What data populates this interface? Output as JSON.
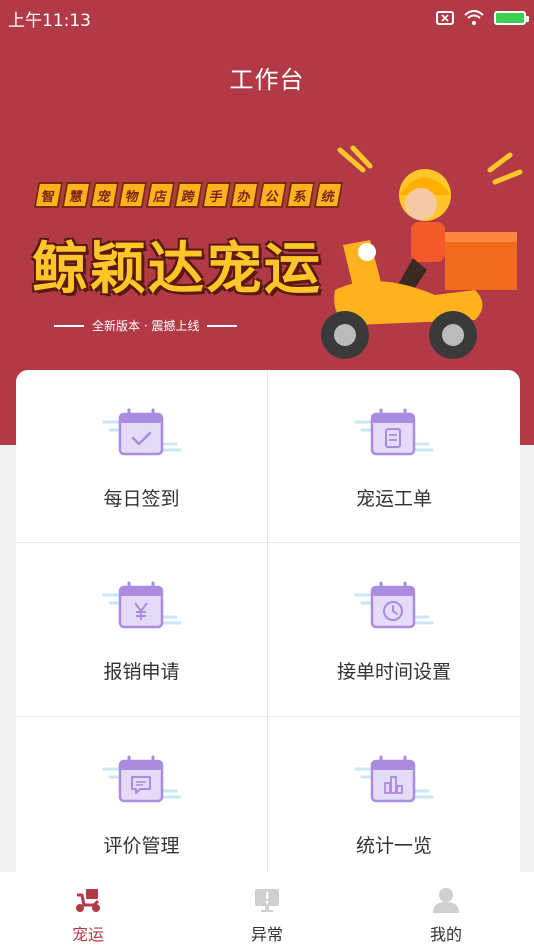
{
  "status_bar": {
    "time": "上午11:13"
  },
  "header": {
    "title": "工作台"
  },
  "banner": {
    "tagline_chars": [
      "智",
      "慧",
      "宠",
      "物",
      "店",
      "跨",
      "手",
      "办",
      "公",
      "系",
      "统"
    ],
    "brand": "鲸颖达宠运",
    "subtitle": "全新版本 · 震撼上线"
  },
  "grid": {
    "items": [
      {
        "label": "每日签到",
        "icon": "calendar-check-icon"
      },
      {
        "label": "宠运工单",
        "icon": "calendar-document-icon"
      },
      {
        "label": "报销申请",
        "icon": "calendar-yen-icon"
      },
      {
        "label": "接单时间设置",
        "icon": "calendar-clock-icon"
      },
      {
        "label": "评价管理",
        "icon": "calendar-message-icon"
      },
      {
        "label": "统计一览",
        "icon": "calendar-chart-icon"
      }
    ]
  },
  "tabbar": {
    "items": [
      {
        "label": "宠运",
        "icon": "scooter-icon",
        "active": true
      },
      {
        "label": "异常",
        "icon": "alert-monitor-icon",
        "active": false
      },
      {
        "label": "我的",
        "icon": "user-icon",
        "active": false
      }
    ]
  },
  "colors": {
    "primary": "#b23a47",
    "accent": "#ffc629",
    "icon_purple": "#a98be0"
  }
}
